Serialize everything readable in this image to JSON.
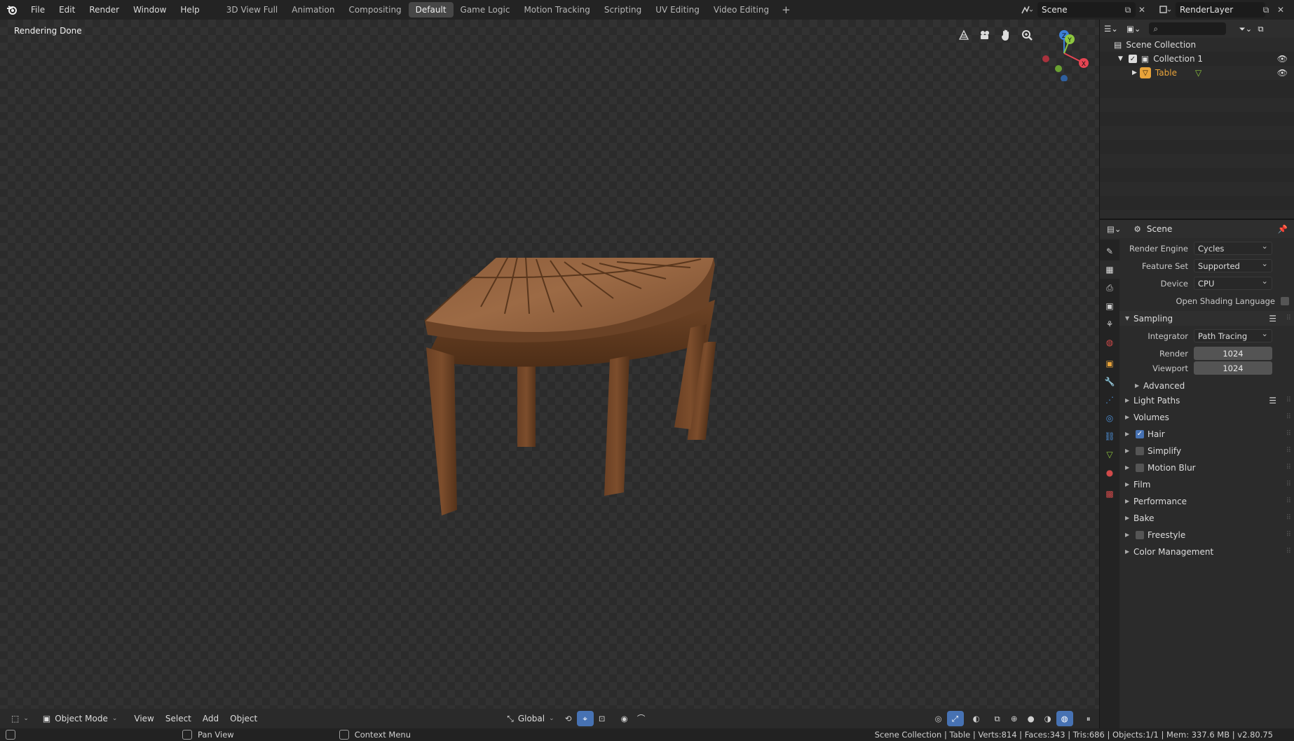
{
  "topbar": {
    "menus": [
      "File",
      "Edit",
      "Render",
      "Window",
      "Help"
    ],
    "workspaces": [
      "3D View Full",
      "Animation",
      "Compositing",
      "Default",
      "Game Logic",
      "Motion Tracking",
      "Scripting",
      "UV Editing",
      "Video Editing"
    ],
    "active_workspace": "Default",
    "add_workspace": "+",
    "scene_name": "Scene",
    "view_layer_name": "RenderLayer"
  },
  "viewport": {
    "status": "Rendering Done",
    "tools": [
      "grid-view-icon",
      "camera-icon",
      "hand-pan-icon",
      "zoom-icon"
    ],
    "gizmo_axes": [
      "X",
      "Y",
      "Z"
    ],
    "header": {
      "mode": "Object Mode",
      "menus": [
        "View",
        "Select",
        "Add",
        "Object"
      ],
      "transform_orientation": "Global"
    }
  },
  "outliner": {
    "root": "Scene Collection",
    "collection": "Collection 1",
    "object": "Table"
  },
  "properties": {
    "context": "Scene",
    "render_engine_label": "Render Engine",
    "render_engine": "Cycles",
    "feature_set_label": "Feature Set",
    "feature_set": "Supported",
    "device_label": "Device",
    "device": "CPU",
    "osl_label": "Open Shading Language",
    "sampling": {
      "title": "Sampling",
      "integrator_label": "Integrator",
      "integrator": "Path Tracing",
      "render_label": "Render",
      "render": "1024",
      "viewport_label": "Viewport",
      "viewport": "1024",
      "advanced": "Advanced"
    },
    "panels": {
      "light_paths": "Light Paths",
      "volumes": "Volumes",
      "hair": "Hair",
      "simplify": "Simplify",
      "motion_blur": "Motion Blur",
      "film": "Film",
      "performance": "Performance",
      "bake": "Bake",
      "freestyle": "Freestyle",
      "color_management": "Color Management"
    }
  },
  "statusbar": {
    "pan": "Pan View",
    "context": "Context Menu",
    "stats": "Scene Collection | Table | Verts:814 | Faces:343 | Tris:686 | Objects:1/1 | Mem: 337.6 MB | v2.80.75"
  },
  "colors": {
    "accent": "#4772b3",
    "object_highlight": "#e8a33a",
    "x_axis": "#e54553",
    "y_axis": "#8dc63f",
    "z_axis": "#3c7fd8"
  }
}
